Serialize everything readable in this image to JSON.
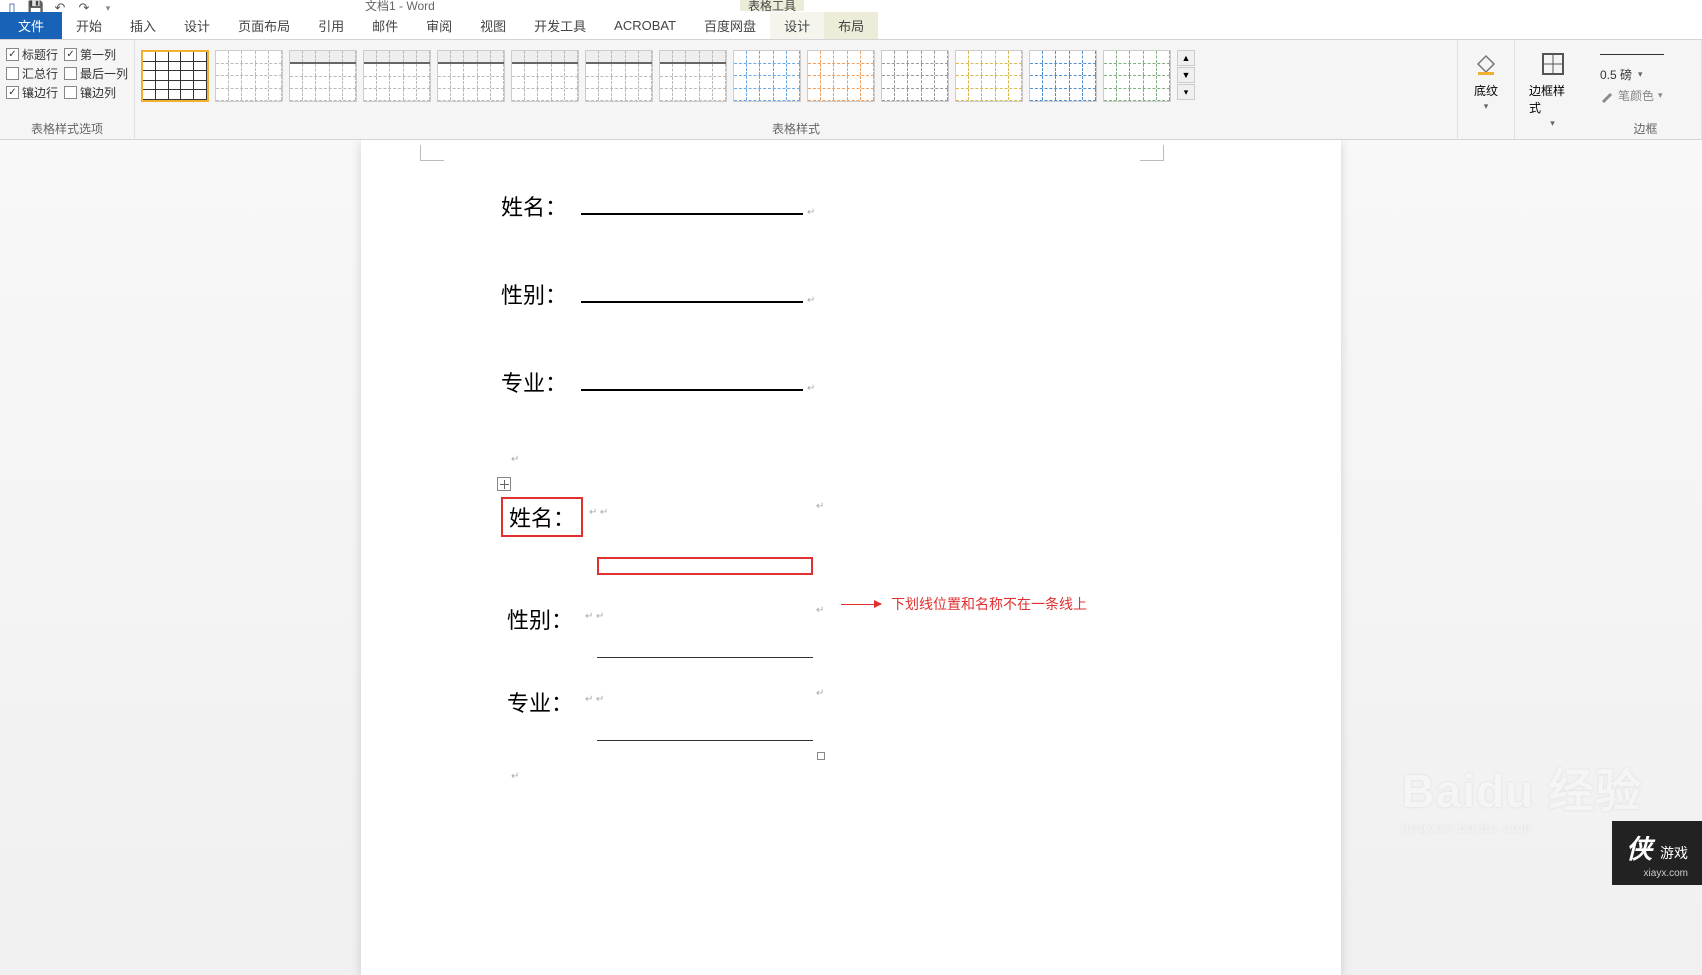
{
  "window_title": "文档1 - Word",
  "context_tool_label": "表格工具",
  "tabs": {
    "file": "文件",
    "home": "开始",
    "insert": "插入",
    "design": "设计",
    "layout": "页面布局",
    "references": "引用",
    "mailings": "邮件",
    "review": "审阅",
    "view": "视图",
    "developer": "开发工具",
    "acrobat": "ACROBAT",
    "baidu": "百度网盘",
    "table_design": "设计",
    "table_layout": "布局"
  },
  "style_options": {
    "header_row": "标题行",
    "first_col": "第一列",
    "total_row": "汇总行",
    "last_col": "最后一列",
    "banded_row": "镶边行",
    "banded_col": "镶边列",
    "group_label": "表格样式选项"
  },
  "checks": {
    "header_row": true,
    "first_col": true,
    "total_row": false,
    "last_col": false,
    "banded_row": true,
    "banded_col": false
  },
  "table_styles_label": "表格样式",
  "shading_label": "底纹",
  "border_style_label": "边框样式",
  "border_weight": "0.5 磅",
  "pen_color_label": "笔颜色",
  "borders_group_label": "边框",
  "doc_fields": {
    "name": "姓名：",
    "gender": "性别：",
    "major": "专业："
  },
  "annotation": "下划线位置和名称不在一条线上",
  "watermarks": {
    "baidu_main": "Baidu 经验",
    "baidu_sub": "jingyan.baidu.com",
    "ali_logo": "侠",
    "ali_text": "游戏",
    "ali_url": "xiayx.com"
  }
}
